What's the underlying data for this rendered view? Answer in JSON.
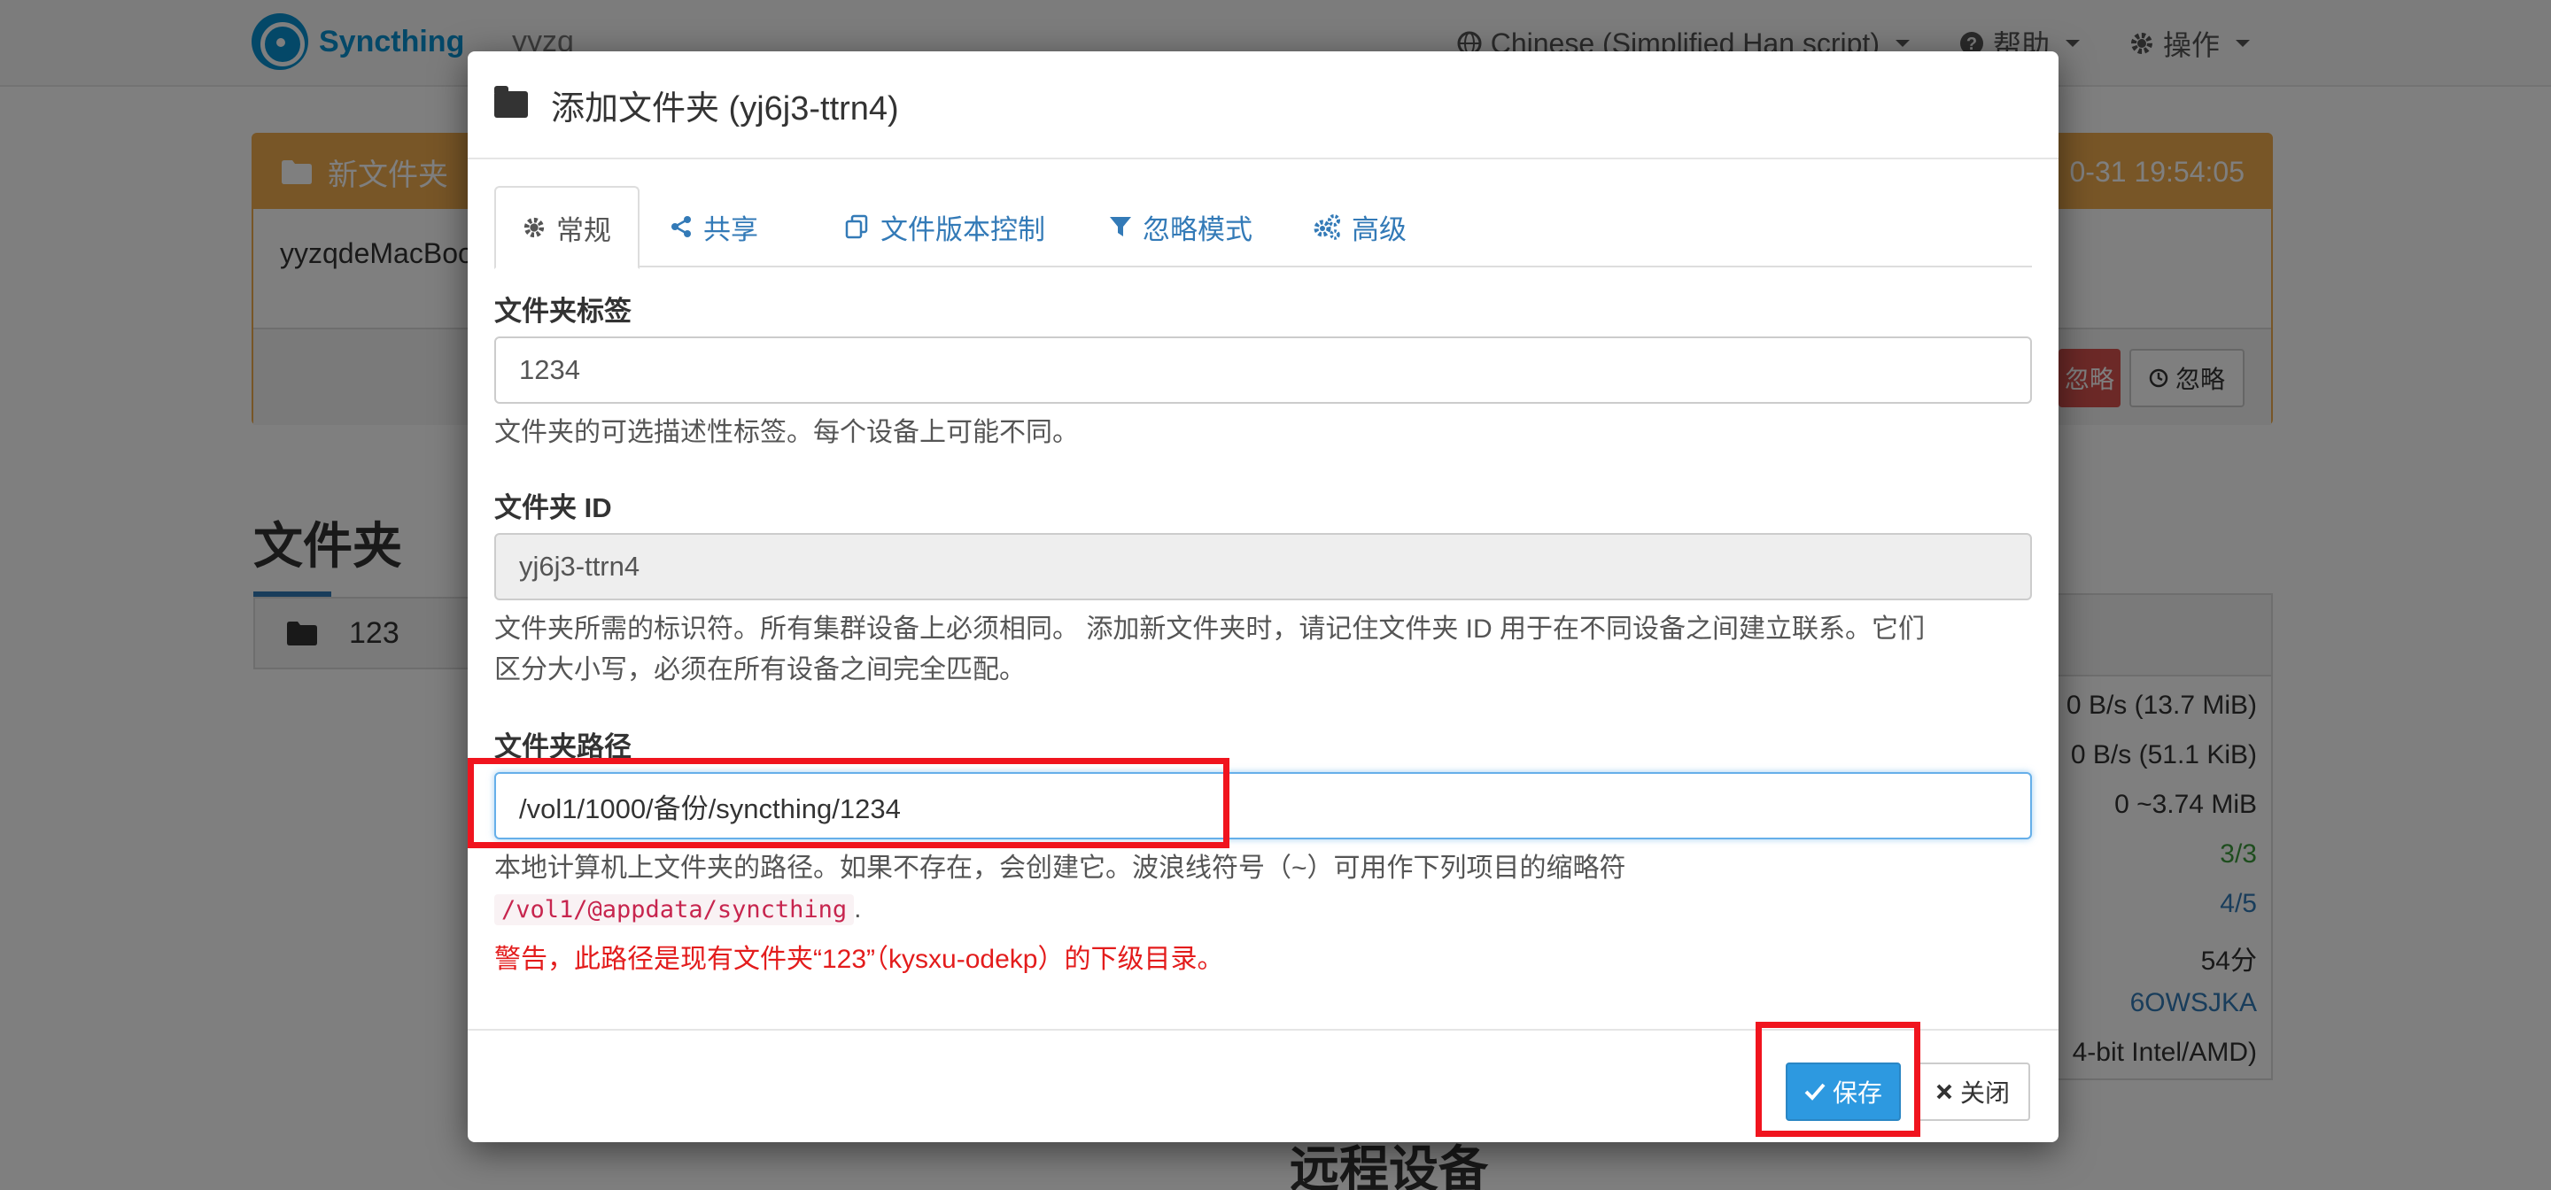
{
  "navbar": {
    "brand": "Syncthing",
    "device_name": "yyzq",
    "language_menu": "Chinese (Simplified Han script)",
    "help_menu": "帮助",
    "actions_menu": "操作"
  },
  "notification": {
    "title": "新文件夹",
    "timestamp": "0-31 19:54:05",
    "body": "yyzqdeMacBoo",
    "ignore_red_label": "忽略",
    "ignore_label": "忽略"
  },
  "folders_section": {
    "title": "文件夹",
    "folder_name": "123"
  },
  "side_panel": {
    "rows": [
      "0 B/s (13.7 MiB)",
      "0 B/s (51.1 KiB)",
      "0  ~3.74 MiB",
      "3/3",
      "4/5",
      "54分",
      "6OWSJKA",
      "4-bit Intel/AMD)"
    ]
  },
  "remote_section": {
    "title": "远程设备"
  },
  "modal": {
    "title": "添加文件夹 (yj6j3-ttrn4)",
    "tabs": [
      {
        "label": "常规",
        "icon": "gear-icon"
      },
      {
        "label": "共享",
        "icon": "share-icon"
      },
      {
        "label": "文件版本控制",
        "icon": "copy-icon"
      },
      {
        "label": "忽略模式",
        "icon": "filter-icon"
      },
      {
        "label": "高级",
        "icon": "cogs-icon"
      }
    ],
    "folder_label": {
      "label": "文件夹标签",
      "value": "1234",
      "help": "文件夹的可选描述性标签。每个设备上可能不同。"
    },
    "folder_id": {
      "label": "文件夹 ID",
      "value": "yj6j3-ttrn4",
      "help_line1": "文件夹所需的标识符。所有集群设备上必须相同。 添加新文件夹时，请记住文件夹 ID 用于在不同设备之间建立联系。它们",
      "help_line2": "区分大小写，必须在所有设备之间完全匹配。"
    },
    "folder_path": {
      "label": "文件夹路径",
      "value": "/vol1/1000/备份/syncthing/1234",
      "help": "本地计算机上文件夹的路径。如果不存在，会创建它。波浪线符号（~）可用作下列项目的缩略符",
      "tilde_path": "/vol1/@appdata/syncthing",
      "tilde_suffix": ".",
      "warning": "警告，此路径是现有文件夹“123”（kysxu-odekp）的下级目录。"
    },
    "save_label": "保存",
    "close_label": "关闭"
  },
  "colors": {
    "brand": "#0891d1",
    "warning_panel": "#f0ad4e",
    "primary_button": "#2d99e0",
    "link": "#337ab7",
    "warning_text": "#e31c1c",
    "highlight_box": "#f0141e"
  }
}
